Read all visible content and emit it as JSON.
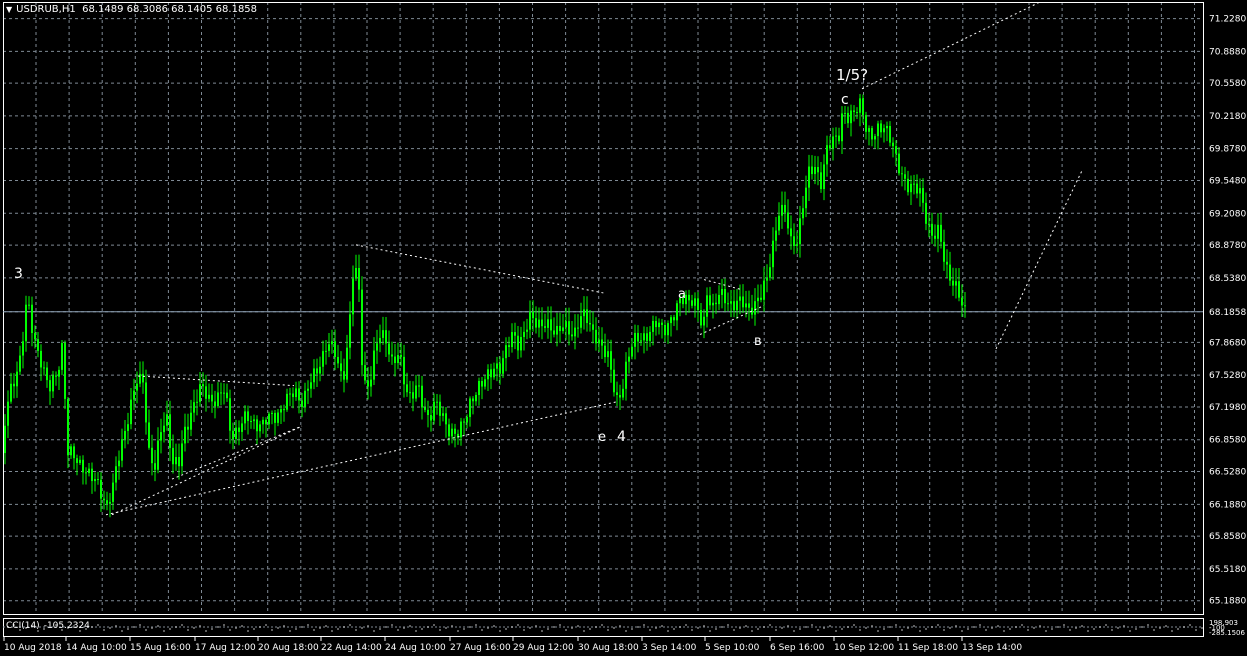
{
  "header": {
    "symbol_tf": "USDRUB,H1",
    "ohlc": "68.1489 68.3086 68.1405 68.1858"
  },
  "indicator": {
    "name": "CCI(14)",
    "value": "-105.2324",
    "scale_top": "198.903",
    "scale_mid": "-100",
    "scale_bottom": "-285.1506"
  },
  "colors": {
    "background": "#000000",
    "grid": "#7f8a95",
    "candle": "#00ff00",
    "text": "#ffffff",
    "price_line": "#8fa3b8"
  },
  "chart_data": {
    "type": "candlestick",
    "grid": true,
    "ylim": [
      65.05,
      71.4
    ],
    "y_ticks": [
      "71.2280",
      "70.8880",
      "70.5580",
      "70.2180",
      "69.8780",
      "69.5480",
      "69.2080",
      "68.8780",
      "68.5380",
      "68.1858",
      "67.8680",
      "67.5280",
      "67.1980",
      "66.8580",
      "66.5280",
      "66.1880",
      "65.8580",
      "65.5180",
      "65.1880"
    ],
    "current_price": "68.1858",
    "x_labels": [
      "10 Aug 2018",
      "14 Aug 10:00",
      "15 Aug 16:00",
      "17 Aug 12:00",
      "20 Aug 18:00",
      "22 Aug 14:00",
      "24 Aug 10:00",
      "27 Aug 16:00",
      "29 Aug 12:00",
      "30 Aug 18:00",
      "3 Sep 14:00",
      "5 Sep 10:00",
      "6 Sep 16:00",
      "10 Sep 12:00",
      "11 Sep 18:00",
      "13 Sep 14:00"
    ],
    "price_path": [
      [
        0,
        66.72
      ],
      [
        8,
        67.3
      ],
      [
        20,
        67.75
      ],
      [
        26,
        68.3
      ],
      [
        32,
        67.95
      ],
      [
        40,
        67.7
      ],
      [
        48,
        67.35
      ],
      [
        56,
        67.55
      ],
      [
        62,
        67.9
      ],
      [
        66,
        66.72
      ],
      [
        74,
        66.66
      ],
      [
        82,
        66.6
      ],
      [
        90,
        66.45
      ],
      [
        98,
        66.38
      ],
      [
        106,
        66.18
      ],
      [
        112,
        66.35
      ],
      [
        120,
        66.8
      ],
      [
        128,
        67.15
      ],
      [
        136,
        67.45
      ],
      [
        142,
        67.48
      ],
      [
        148,
        66.75
      ],
      [
        154,
        66.55
      ],
      [
        160,
        66.95
      ],
      [
        166,
        67.1
      ],
      [
        172,
        66.62
      ],
      [
        178,
        66.6
      ],
      [
        184,
        66.95
      ],
      [
        192,
        67.22
      ],
      [
        200,
        67.38
      ],
      [
        208,
        67.3
      ],
      [
        216,
        67.28
      ],
      [
        224,
        67.36
      ],
      [
        230,
        66.92
      ],
      [
        238,
        66.98
      ],
      [
        246,
        67.08
      ],
      [
        254,
        67.05
      ],
      [
        262,
        67.0
      ],
      [
        270,
        67.1
      ],
      [
        278,
        67.15
      ],
      [
        286,
        67.25
      ],
      [
        294,
        67.38
      ],
      [
        302,
        67.25
      ],
      [
        310,
        67.45
      ],
      [
        318,
        67.65
      ],
      [
        326,
        67.85
      ],
      [
        334,
        67.75
      ],
      [
        342,
        67.5
      ],
      [
        348,
        67.95
      ],
      [
        353,
        68.7
      ],
      [
        358,
        68.4
      ],
      [
        362,
        67.5
      ],
      [
        368,
        67.4
      ],
      [
        374,
        67.75
      ],
      [
        380,
        68.0
      ],
      [
        386,
        67.9
      ],
      [
        392,
        67.6
      ],
      [
        398,
        67.75
      ],
      [
        404,
        67.45
      ],
      [
        410,
        67.3
      ],
      [
        416,
        67.4
      ],
      [
        422,
        67.2
      ],
      [
        428,
        67.1
      ],
      [
        434,
        67.25
      ],
      [
        440,
        67.1
      ],
      [
        446,
        67.0
      ],
      [
        452,
        66.95
      ],
      [
        458,
        66.9
      ],
      [
        464,
        67.05
      ],
      [
        470,
        67.3
      ],
      [
        476,
        67.38
      ],
      [
        482,
        67.42
      ],
      [
        488,
        67.55
      ],
      [
        494,
        67.65
      ],
      [
        500,
        67.58
      ],
      [
        506,
        67.8
      ],
      [
        512,
        68.0
      ],
      [
        518,
        67.85
      ],
      [
        524,
        67.95
      ],
      [
        530,
        68.15
      ],
      [
        536,
        68.1
      ],
      [
        542,
        68.05
      ],
      [
        548,
        68.0
      ],
      [
        554,
        67.98
      ],
      [
        560,
        68.08
      ],
      [
        566,
        68.0
      ],
      [
        572,
        67.88
      ],
      [
        578,
        68.15
      ],
      [
        584,
        68.2
      ],
      [
        590,
        67.95
      ],
      [
        596,
        67.9
      ],
      [
        602,
        67.85
      ],
      [
        608,
        67.7
      ],
      [
        612,
        67.4
      ],
      [
        616,
        67.25
      ],
      [
        620,
        67.35
      ],
      [
        626,
        67.7
      ],
      [
        632,
        67.85
      ],
      [
        638,
        67.9
      ],
      [
        644,
        67.95
      ],
      [
        650,
        68.0
      ],
      [
        656,
        68.05
      ],
      [
        662,
        68.0
      ],
      [
        668,
        68.1
      ],
      [
        674,
        68.15
      ],
      [
        680,
        68.3
      ],
      [
        686,
        68.35
      ],
      [
        692,
        68.32
      ],
      [
        698,
        68.15
      ],
      [
        702,
        67.95
      ],
      [
        706,
        68.4
      ],
      [
        712,
        68.25
      ],
      [
        718,
        68.35
      ],
      [
        724,
        68.3
      ],
      [
        730,
        68.28
      ],
      [
        736,
        68.3
      ],
      [
        742,
        68.25
      ],
      [
        748,
        68.2
      ],
      [
        754,
        68.3
      ],
      [
        760,
        68.35
      ],
      [
        766,
        68.5
      ],
      [
        772,
        68.9
      ],
      [
        778,
        69.25
      ],
      [
        784,
        69.2
      ],
      [
        790,
        68.9
      ],
      [
        796,
        68.95
      ],
      [
        802,
        69.3
      ],
      [
        808,
        69.6
      ],
      [
        814,
        69.7
      ],
      [
        820,
        69.55
      ],
      [
        826,
        69.85
      ],
      [
        832,
        69.95
      ],
      [
        838,
        70.05
      ],
      [
        842,
        70.3
      ],
      [
        848,
        70.15
      ],
      [
        854,
        70.25
      ],
      [
        860,
        70.4
      ],
      [
        866,
        70.05
      ],
      [
        872,
        69.95
      ],
      [
        878,
        70.1
      ],
      [
        884,
        70.15
      ],
      [
        890,
        69.95
      ],
      [
        896,
        69.7
      ],
      [
        902,
        69.6
      ],
      [
        908,
        69.5
      ],
      [
        914,
        69.45
      ],
      [
        920,
        69.4
      ],
      [
        926,
        69.15
      ],
      [
        932,
        68.95
      ],
      [
        938,
        69.0
      ],
      [
        944,
        68.7
      ],
      [
        950,
        68.55
      ],
      [
        956,
        68.4
      ],
      [
        962,
        68.2
      ],
      [
        966,
        68.19
      ]
    ],
    "wave_labels": [
      "3",
      "a",
      "в",
      "e",
      "4",
      "c",
      "1/5?"
    ],
    "trendlines": [
      {
        "from": [
          106,
          66.08
        ],
        "to": [
          616,
          67.25
        ]
      },
      {
        "from": [
          112,
          66.08
        ],
        "to": [
          302,
          67.0
        ]
      },
      {
        "from": [
          138,
          67.52
        ],
        "to": [
          294,
          67.42
        ]
      },
      {
        "from": [
          172,
          66.45
        ],
        "to": [
          302,
          67.0
        ]
      },
      {
        "from": [
          356,
          68.88
        ],
        "to": [
          604,
          68.38
        ]
      },
      {
        "from": [
          700,
          67.95
        ],
        "to": [
          764,
          68.25
        ]
      },
      {
        "from": [
          704,
          68.52
        ],
        "to": [
          740,
          68.42
        ]
      },
      {
        "from": [
          862,
          70.5
        ],
        "to": [
          1040,
          71.4
        ]
      },
      {
        "from": [
          996,
          67.8
        ],
        "to": [
          1082,
          69.65
        ]
      }
    ]
  }
}
